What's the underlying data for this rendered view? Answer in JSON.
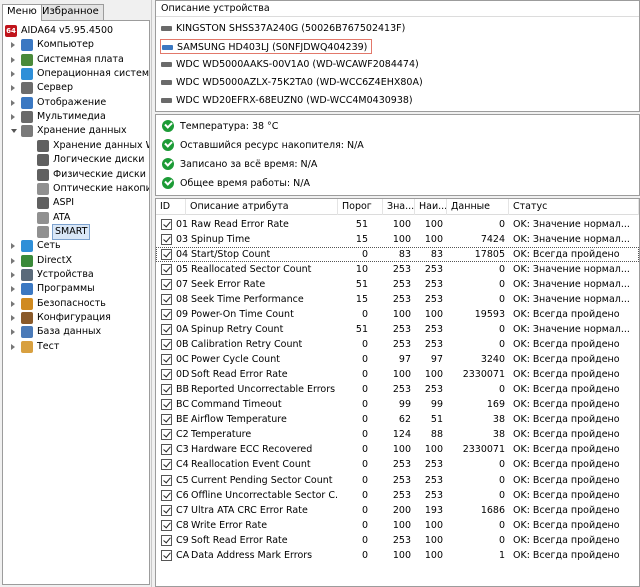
{
  "sidebar": {
    "tabs": [
      "Меню",
      "Избранное"
    ],
    "tree": [
      {
        "label": "AIDA64 v5.95.4500",
        "icon": "aida64-logo-icon",
        "color": "#c0141b",
        "level": 0,
        "expander": "none"
      },
      {
        "label": "Компьютер",
        "icon": "computer-icon",
        "color": "#3b78c2",
        "level": 1,
        "expander": "closed"
      },
      {
        "label": "Системная плата",
        "icon": "motherboard-icon",
        "color": "#4a8a3a",
        "level": 1,
        "expander": "closed"
      },
      {
        "label": "Операционная система",
        "icon": "windows-icon",
        "color": "#2f8fd8",
        "level": 1,
        "expander": "closed"
      },
      {
        "label": "Сервер",
        "icon": "server-icon",
        "color": "#6d6d6d",
        "level": 1,
        "expander": "closed"
      },
      {
        "label": "Отображение",
        "icon": "monitor-icon",
        "color": "#3b78c2",
        "level": 1,
        "expander": "closed"
      },
      {
        "label": "Мультимедиа",
        "icon": "multimedia-icon",
        "color": "#6a6a6a",
        "level": 1,
        "expander": "closed"
      },
      {
        "label": "Хранение данных",
        "icon": "storage-icon",
        "color": "#7a7a7a",
        "level": 1,
        "expander": "open"
      },
      {
        "label": "Хранение данных Win",
        "icon": "drive-icon",
        "color": "#606060",
        "level": 2,
        "expander": "none"
      },
      {
        "label": "Логические диски",
        "icon": "logical-disk-icon",
        "color": "#606060",
        "level": 2,
        "expander": "none"
      },
      {
        "label": "Физические диски",
        "icon": "physical-disk-icon",
        "color": "#606060",
        "level": 2,
        "expander": "none"
      },
      {
        "label": "Оптические накопите",
        "icon": "optical-drive-icon",
        "color": "#909090",
        "level": 2,
        "expander": "none"
      },
      {
        "label": "ASPI",
        "icon": "aspi-icon",
        "color": "#606060",
        "level": 2,
        "expander": "none"
      },
      {
        "label": "ATA",
        "icon": "ata-icon",
        "color": "#909090",
        "level": 2,
        "expander": "none"
      },
      {
        "label": "SMART",
        "icon": "smart-icon",
        "color": "#909090",
        "level": 2,
        "expander": "none",
        "selected": true
      },
      {
        "label": "Сеть",
        "icon": "network-icon",
        "color": "#2f8fd8",
        "level": 1,
        "expander": "closed"
      },
      {
        "label": "DirectX",
        "icon": "directx-icon",
        "color": "#3a8a3a",
        "level": 1,
        "expander": "closed"
      },
      {
        "label": "Устройства",
        "icon": "devices-icon",
        "color": "#5a6a7a",
        "level": 1,
        "expander": "closed"
      },
      {
        "label": "Программы",
        "icon": "programs-icon",
        "color": "#3b78c2",
        "level": 1,
        "expander": "closed"
      },
      {
        "label": "Безопасность",
        "icon": "security-shield-icon",
        "color": "#d08a20",
        "level": 1,
        "expander": "closed"
      },
      {
        "label": "Конфигурация",
        "icon": "configuration-icon",
        "color": "#8a5a2a",
        "level": 1,
        "expander": "closed"
      },
      {
        "label": "База данных",
        "icon": "database-icon",
        "color": "#4a7ab8",
        "level": 1,
        "expander": "closed"
      },
      {
        "label": "Тест",
        "icon": "benchmark-icon",
        "color": "#d8a040",
        "level": 1,
        "expander": "closed"
      }
    ]
  },
  "devices": {
    "header": "Описание устройства",
    "items": [
      {
        "label": "KINGSTON SHSS37A240G (50026B767502413F)",
        "selected": false
      },
      {
        "label": "SAMSUNG HD403LJ (S0NFJDWQ404239)",
        "selected": true
      },
      {
        "label": "WDC WD5000AAKS-00V1A0 (WD-WCAWF2084474)",
        "selected": false
      },
      {
        "label": "WDC WD5000AZLX-75K2TA0 (WD-WCC6Z4EHX80A)",
        "selected": false
      },
      {
        "label": "WDC WD20EFRX-68EUZN0 (WD-WCC4M0430938)",
        "selected": false
      }
    ]
  },
  "status": [
    {
      "label": "Температура: 38 °C"
    },
    {
      "label": "Оставшийся ресурс накопителя: N/A"
    },
    {
      "label": "Записано за всё время: N/A"
    },
    {
      "label": "Общее время работы: N/A"
    }
  ],
  "smart": {
    "columns": [
      "ID",
      "Описание атрибута",
      "Порог",
      "Зна...",
      "Наи...",
      "Данные",
      "Статус"
    ],
    "rows": [
      [
        "01",
        "Raw Read Error Rate",
        "51",
        "100",
        "100",
        "0",
        "OK: Значение нормал..."
      ],
      [
        "03",
        "Spinup Time",
        "15",
        "100",
        "100",
        "7424",
        "OK: Значение нормал..."
      ],
      [
        "04",
        "Start/Stop Count",
        "0",
        "83",
        "83",
        "17805",
        "OK: Всегда пройдено"
      ],
      [
        "05",
        "Reallocated Sector Count",
        "10",
        "253",
        "253",
        "0",
        "OK: Значение нормал..."
      ],
      [
        "07",
        "Seek Error Rate",
        "51",
        "253",
        "253",
        "0",
        "OK: Значение нормал..."
      ],
      [
        "08",
        "Seek Time Performance",
        "15",
        "253",
        "253",
        "0",
        "OK: Значение нормал..."
      ],
      [
        "09",
        "Power-On Time Count",
        "0",
        "100",
        "100",
        "19593",
        "OK: Всегда пройдено"
      ],
      [
        "0A",
        "Spinup Retry Count",
        "51",
        "253",
        "253",
        "0",
        "OK: Значение нормал..."
      ],
      [
        "0B",
        "Calibration Retry Count",
        "0",
        "253",
        "253",
        "0",
        "OK: Всегда пройдено"
      ],
      [
        "0C",
        "Power Cycle Count",
        "0",
        "97",
        "97",
        "3240",
        "OK: Всегда пройдено"
      ],
      [
        "0D",
        "Soft Read Error Rate",
        "0",
        "100",
        "100",
        "2330071",
        "OK: Всегда пройдено"
      ],
      [
        "BB",
        "Reported Uncorrectable Errors",
        "0",
        "253",
        "253",
        "0",
        "OK: Всегда пройдено"
      ],
      [
        "BC",
        "Command Timeout",
        "0",
        "99",
        "99",
        "169",
        "OK: Всегда пройдено"
      ],
      [
        "BE",
        "Airflow Temperature",
        "0",
        "62",
        "51",
        "38",
        "OK: Всегда пройдено"
      ],
      [
        "C2",
        "Temperature",
        "0",
        "124",
        "88",
        "38",
        "OK: Всегда пройдено"
      ],
      [
        "C3",
        "Hardware ECC Recovered",
        "0",
        "100",
        "100",
        "2330071",
        "OK: Всегда пройдено"
      ],
      [
        "C4",
        "Reallocation Event Count",
        "0",
        "253",
        "253",
        "0",
        "OK: Всегда пройдено"
      ],
      [
        "C5",
        "Current Pending Sector Count",
        "0",
        "253",
        "253",
        "0",
        "OK: Всегда пройдено"
      ],
      [
        "C6",
        "Offline Uncorrectable Sector C...",
        "0",
        "253",
        "253",
        "0",
        "OK: Всегда пройдено"
      ],
      [
        "C7",
        "Ultra ATA CRC Error Rate",
        "0",
        "200",
        "193",
        "1686",
        "OK: Всегда пройдено"
      ],
      [
        "C8",
        "Write Error Rate",
        "0",
        "100",
        "100",
        "0",
        "OK: Всегда пройдено"
      ],
      [
        "C9",
        "Soft Read Error Rate",
        "0",
        "253",
        "100",
        "0",
        "OK: Всегда пройдено"
      ],
      [
        "CA",
        "Data Address Mark Errors",
        "0",
        "100",
        "100",
        "1",
        "OK: Всегда пройдено"
      ]
    ],
    "focused_row": 2
  }
}
